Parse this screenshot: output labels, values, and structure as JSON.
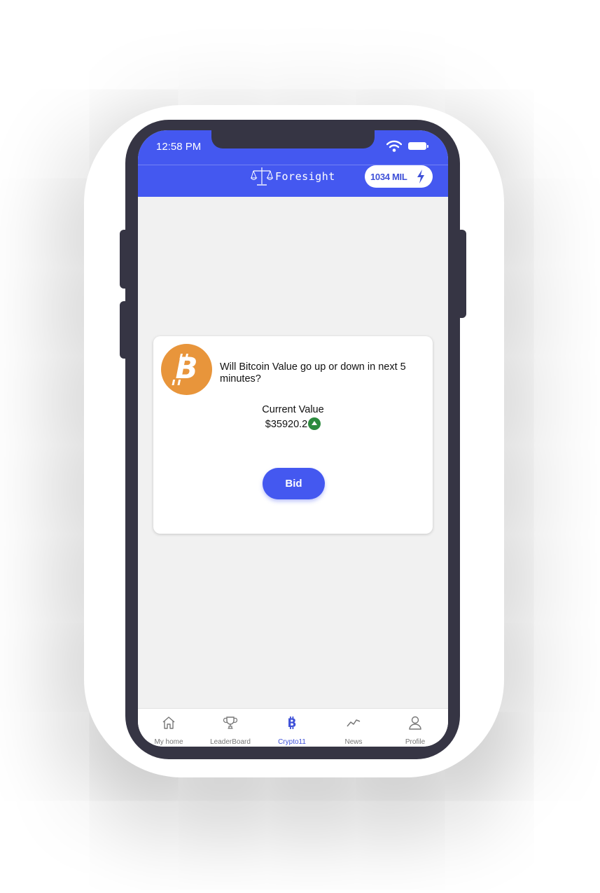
{
  "status_bar": {
    "time": "12:58 PM"
  },
  "header": {
    "brand": "Foresight",
    "coins": "1034 MIL"
  },
  "card": {
    "question": "Will  Bitcoin Value go up or down in next 5 minutes?",
    "current_value_label": "Current Value",
    "current_value": "$35920.2",
    "trend": "up",
    "bid_label": "Bid"
  },
  "nav": {
    "items": [
      {
        "label": "My home",
        "icon": "home-icon",
        "active": false
      },
      {
        "label": "LeaderBoard",
        "icon": "trophy-icon",
        "active": false
      },
      {
        "label": "Crypto11",
        "icon": "bitcoin-icon",
        "active": true
      },
      {
        "label": "News",
        "icon": "trend-line-icon",
        "active": false
      },
      {
        "label": "Profile",
        "icon": "user-icon",
        "active": false
      }
    ]
  },
  "colors": {
    "primary": "#4458f0",
    "bitcoin_orange": "#e8953b",
    "up_green": "#2c8a3e",
    "phone_frame": "#363544"
  }
}
